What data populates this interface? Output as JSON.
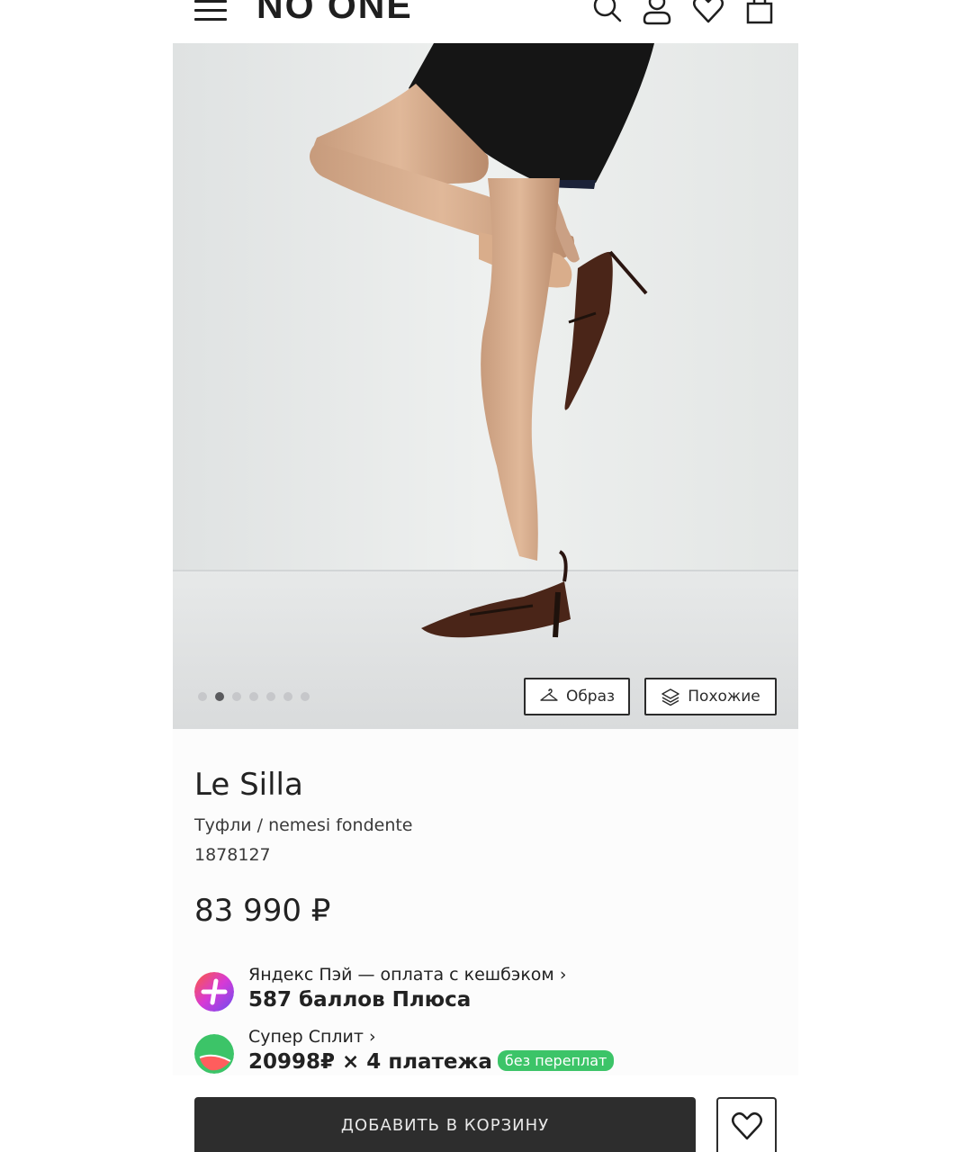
{
  "header": {
    "logo": "NO ONE",
    "icons": [
      "menu-icon",
      "search-icon",
      "profile-icon",
      "heart-icon",
      "bag-icon"
    ]
  },
  "gallery": {
    "dots_count": 7,
    "active_dot": 2,
    "look_label": "Образ",
    "similar_label": "Похожие"
  },
  "product": {
    "brand": "Le Silla",
    "subtitle": "Туфли / nemesi fondente",
    "sku": "1878127",
    "price": "83 990 ₽"
  },
  "payments": {
    "yandex": {
      "title": "Яндекс Пэй — оплата с кешбэком",
      "value": "587 баллов Плюса"
    },
    "split": {
      "title": "Супер Сплит",
      "value": "20998₽ × 4 платежа",
      "badge": "без переплат"
    }
  },
  "actions": {
    "add_to_cart": "ДОБАВИТЬ В КОРЗИНУ"
  },
  "colors": {
    "dark": "#2d2d2d",
    "badge_green": "#3cc468",
    "shoe": "#4a2518"
  }
}
